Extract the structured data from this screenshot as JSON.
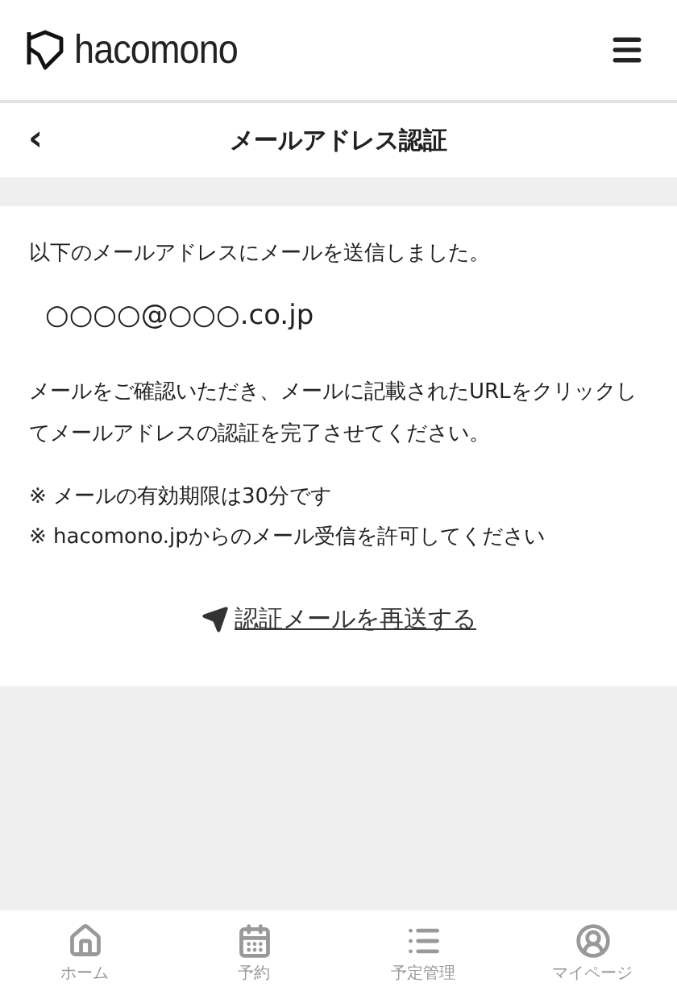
{
  "header": {
    "logo": "hacomono"
  },
  "title_bar": {
    "back": "‹",
    "title": "メールアドレス認証"
  },
  "content": {
    "intro": "以下のメールアドレスにメールを送信しました。",
    "email": "○○○○@○○○.co.jp",
    "instruction": "メールをご確認いただき、メールに記載されたURLをクリックしてメールアドレスの認証を完了させてください。",
    "notes": [
      "※ メールの有効期限は30分です",
      "※ hacomono.jpからのメール受信を許可してください"
    ],
    "resend_link": "認証メールを再送する"
  },
  "bottom_nav": [
    {
      "kind": "home",
      "label": "ホーム"
    },
    {
      "kind": "calendar",
      "label": "予約"
    },
    {
      "kind": "list",
      "label": "予定管理"
    },
    {
      "kind": "user",
      "label": "マイページ"
    }
  ]
}
